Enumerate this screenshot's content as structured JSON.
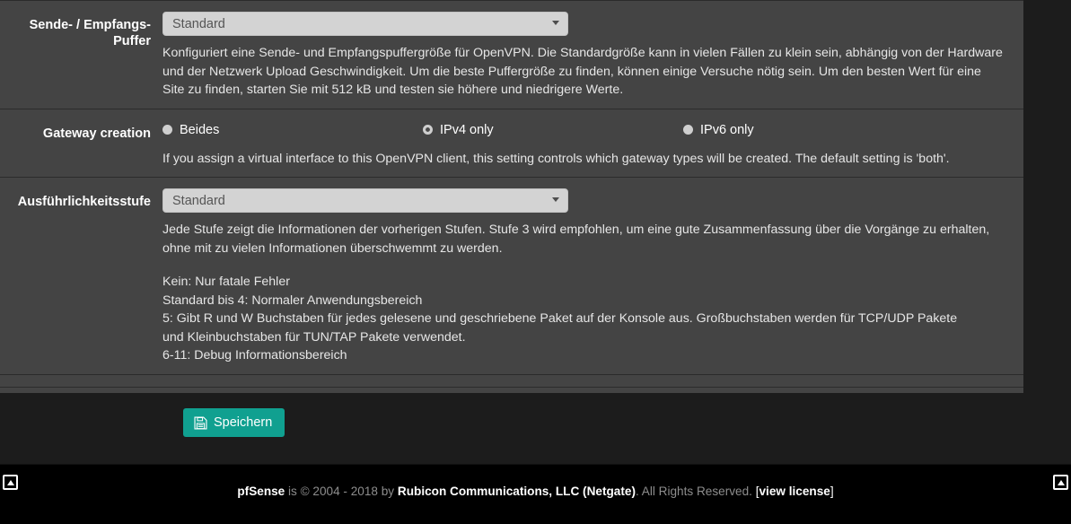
{
  "form": {
    "rows": [
      {
        "label": "Sende- / Empfangs-\nPuffer",
        "select_value": "Standard",
        "help": "Konfiguriert eine Sende- und Empfangspuffergröße für OpenVPN. Die Standardgröße kann in vielen Fällen zu klein sein, abhängig von der Hardware und der Netzwerk Upload Geschwindigkeit. Um die beste Puffergröße zu finden, können einige Versuche nötig sein. Um den besten Wert für eine Site zu finden, starten Sie mit 512 kB und testen sie höhere und niedrigere Werte."
      },
      {
        "label": "Gateway creation",
        "help": "If you assign a virtual interface to this OpenVPN client, this setting controls which gateway types will be created. The default setting is 'both'.",
        "radios": [
          {
            "label": "Beides",
            "checked": false
          },
          {
            "label": "IPv4 only",
            "checked": true
          },
          {
            "label": "IPv6 only",
            "checked": false
          }
        ]
      },
      {
        "label": "Ausführlichkeitsstufe",
        "select_value": "Standard",
        "help": "Jede Stufe zeigt die Informationen der vorherigen Stufen. Stufe 3 wird empfohlen, um eine gute Zusammenfassung über die Vorgänge zu erhalten, ohne mit zu vielen Informationen überschwemmt zu werden.",
        "help_block": "Kein: Nur fatale Fehler\nStandard bis 4: Normaler Anwendungsbereich\n5: Gibt R und W Buchstaben für jedes gelesene und geschriebene Paket auf der Konsole aus. Großbuchstaben werden für TCP/UDP Pakete und Kleinbuchstaben für TUN/TAP Pakete verwendet.\n6-11: Debug Informationsbereich"
      }
    ]
  },
  "actions": {
    "save_label": "Speichern",
    "save_icon": "floppy-disk-icon",
    "save_color": "#10a090"
  },
  "footer": {
    "brand": "pfSense",
    "copy_mid": " is © 2004 - 2018 by ",
    "company": "Rubicon Communications, LLC (Netgate)",
    "rights": ". All Rights Reserved. ",
    "bracket_open": "[",
    "license_link": "view license",
    "bracket_close": "]",
    "scroll_top_icon": "scroll-to-top-icon"
  }
}
